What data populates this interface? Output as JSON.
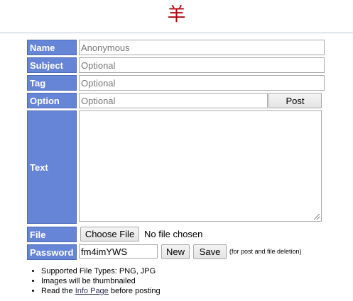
{
  "logo": {
    "text": "羊"
  },
  "form": {
    "name": {
      "label": "Name",
      "placeholder": "Anonymous"
    },
    "subject": {
      "label": "Subject",
      "placeholder": "Optional"
    },
    "tag": {
      "label": "Tag",
      "placeholder": "Optional"
    },
    "option": {
      "label": "Option",
      "placeholder": "Optional",
      "post_button": "Post"
    },
    "text": {
      "label": "Text"
    },
    "file": {
      "label": "File",
      "choose_button": "Choose File",
      "status": "No file chosen"
    },
    "password": {
      "label": "Password",
      "value": "fm4imYWS",
      "new_button": "New",
      "save_button": "Save",
      "note": "(for post and file deletion)"
    }
  },
  "rules": {
    "item1": "Supported File Types: PNG, JPG",
    "item2": "Images will be thumbnailed",
    "item3_prefix": "Read the ",
    "item3_link": "Info Page",
    "item3_suffix": " before posting"
  },
  "colors": {
    "logo": "#af0a0f",
    "label_bg": "#6785d6",
    "link": "#34345c"
  }
}
